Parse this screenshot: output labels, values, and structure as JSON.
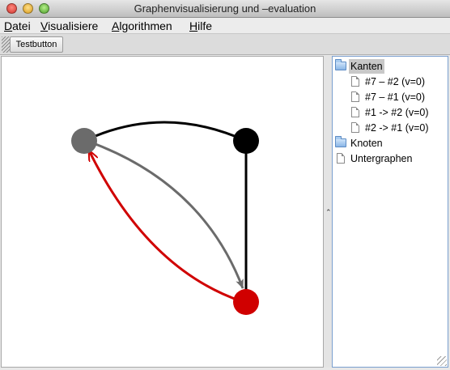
{
  "window": {
    "title": "Graphenvisualisierung und –evaluation"
  },
  "menu": [
    {
      "first": "D",
      "rest": "atei"
    },
    {
      "first": "V",
      "rest": "isualisiere"
    },
    {
      "first": "A",
      "rest": "lgorithmen"
    },
    {
      "first": "H",
      "rest": "ilfe"
    }
  ],
  "toolbar": {
    "test_button": "Testbutton"
  },
  "graph": {
    "colors": {
      "gray": "#6b6b6b",
      "black": "#000000",
      "red": "#d00000"
    },
    "nodes": [
      {
        "id": "gray-node",
        "color": "#6b6b6b"
      },
      {
        "id": "black-node",
        "color": "#000000"
      },
      {
        "id": "red-node",
        "color": "#d00000"
      }
    ]
  },
  "tree": {
    "edges_folder": "Kanten",
    "edges": [
      "#7 – #2 (v=0)",
      "#7 – #1 (v=0)",
      "#1 -> #2 (v=0)",
      "#2 -> #1 (v=0)"
    ],
    "nodes_folder": "Knoten",
    "subgraphs": "Untergraphen"
  }
}
